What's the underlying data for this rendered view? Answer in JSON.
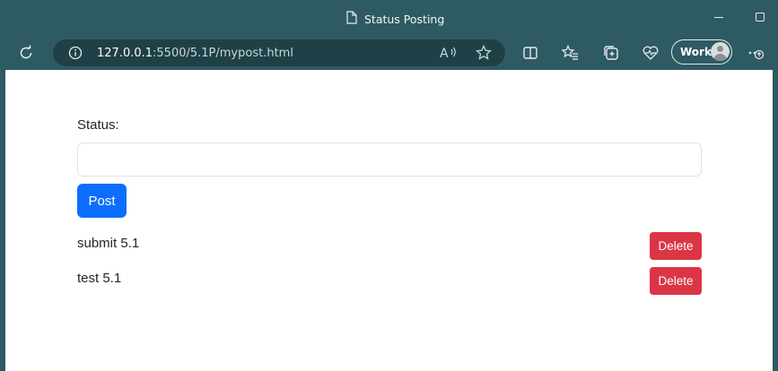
{
  "window": {
    "title": "Status Posting"
  },
  "toolbar": {
    "url_host": "127.0.0.1",
    "url_rest": ":5500/5.1P/mypost.html",
    "profile_label": "Work"
  },
  "form": {
    "status_label": "Status:",
    "status_value": "",
    "post_label": "Post"
  },
  "posts": [
    {
      "text": "submit 5.1",
      "delete_label": "Delete"
    },
    {
      "text": "test 5.1",
      "delete_label": "Delete"
    }
  ],
  "colors": {
    "primary": "#0d6efd",
    "danger": "#dc3545",
    "chrome": "#2e5a63"
  },
  "icons": {
    "tab": "page-icon",
    "reload": "reload-icon",
    "info": "info-icon",
    "read_aloud": "read-aloud-icon",
    "favorite": "star-icon",
    "split": "split-screen-icon",
    "favorites": "favorites-icon",
    "collections": "collections-icon",
    "health": "browser-essentials-icon",
    "more": "more-icon"
  }
}
